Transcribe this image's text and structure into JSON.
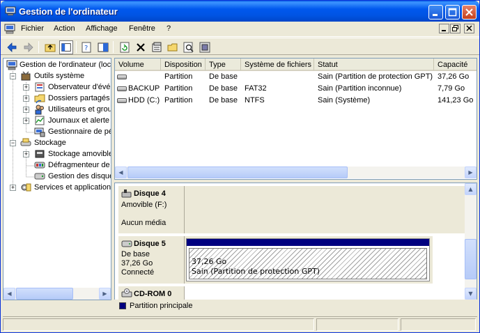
{
  "window": {
    "title": "Gestion de l'ordinateur"
  },
  "menu": {
    "items": [
      "Fichier",
      "Action",
      "Affichage",
      "Fenêtre",
      "?"
    ]
  },
  "toolbar": {
    "icons": [
      "back-arrow-icon",
      "forward-arrow-icon",
      "up-folder-icon",
      "show-hide-tree-icon",
      "properties-icon",
      "help-icon",
      "refresh-icon",
      "delete-icon",
      "properties-sheet-icon",
      "open-icon",
      "search-icon",
      "settings-icon"
    ]
  },
  "tree": {
    "nodes": [
      {
        "label": "Gestion de l'ordinateur (loc",
        "icon": "computer-icon"
      },
      {
        "label": "Outils système",
        "icon": "tools-icon"
      },
      {
        "label": "Observateur d'évé",
        "icon": "event-viewer-icon"
      },
      {
        "label": "Dossiers partagés",
        "icon": "shared-folder-icon"
      },
      {
        "label": "Utilisateurs et grou",
        "icon": "users-icon"
      },
      {
        "label": "Journaux et alerte",
        "icon": "logs-icon"
      },
      {
        "label": "Gestionnaire de pé",
        "icon": "device-manager-icon"
      },
      {
        "label": "Stockage",
        "icon": "storage-icon"
      },
      {
        "label": "Stockage amovible",
        "icon": "removable-storage-icon"
      },
      {
        "label": "Défragmenteur de",
        "icon": "defrag-icon"
      },
      {
        "label": "Gestion des disque",
        "icon": "disk-management-icon"
      },
      {
        "label": "Services et applications",
        "icon": "services-icon"
      }
    ]
  },
  "volumes": {
    "columns": [
      "Volume",
      "Disposition",
      "Type",
      "Système de fichiers",
      "Statut",
      "Capacité"
    ],
    "rows": [
      {
        "volume": "",
        "layout": "Partition",
        "type": "De base",
        "fs": "",
        "status": "Sain (Partition de protection GPT)",
        "capacity": "37,26 Go"
      },
      {
        "volume": "BACKUP",
        "layout": "Partition",
        "type": "De base",
        "fs": "FAT32",
        "status": "Sain (Partition inconnue)",
        "capacity": "7,79 Go"
      },
      {
        "volume": "HDD (C:)",
        "layout": "Partition",
        "type": "De base",
        "fs": "NTFS",
        "status": "Sain (Système)",
        "capacity": "141,23 Go"
      }
    ]
  },
  "disks": {
    "disk4": {
      "name": "Disque 4",
      "line1": "Amovible (F:)",
      "line2": "Aucun média"
    },
    "disk5": {
      "name": "Disque 5",
      "line1": "De base",
      "line2": "37,26 Go",
      "line3": "Connecté",
      "partition_size": "37,26 Go",
      "partition_status": "Sain (Partition de protection GPT)"
    },
    "cdrom": {
      "name": "CD-ROM 0"
    }
  },
  "legend": {
    "label": "Partition principale",
    "color": "#00007f"
  },
  "colors": {
    "title_bar": "#0054e3",
    "partition_bar": "#00007f"
  }
}
